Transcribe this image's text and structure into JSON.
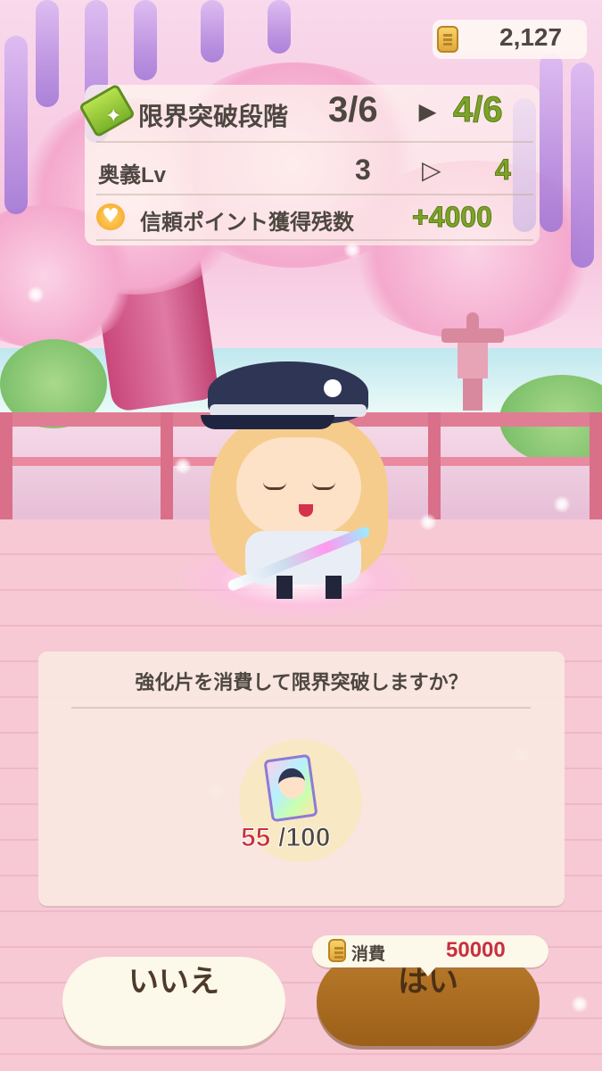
{
  "currency": {
    "amount": "2,127",
    "icon": "coin-icon"
  },
  "limit_break": {
    "title": "限界突破段階",
    "from": "3/6",
    "arrow": "▶",
    "to": "4/6",
    "icon": "ticket-icon"
  },
  "ougi": {
    "label": "奥義Lv",
    "from": "3",
    "arrow": "▷",
    "to": "4"
  },
  "trust": {
    "label": "信頼ポイント獲得残数",
    "value": "+4000",
    "icon": "heart-icon"
  },
  "dialog": {
    "message": "強化片を消費して限界突破しますか？",
    "item_current": "55",
    "item_max": "/100"
  },
  "cost": {
    "label": "消費",
    "value": "50000"
  },
  "buttons": {
    "no": "いいえ",
    "yes": "はい"
  },
  "colors": {
    "green_accent": "#7da42a",
    "red_accent": "#c9303f",
    "yes_button": "#b8792a",
    "no_button": "#fcf8ea"
  }
}
